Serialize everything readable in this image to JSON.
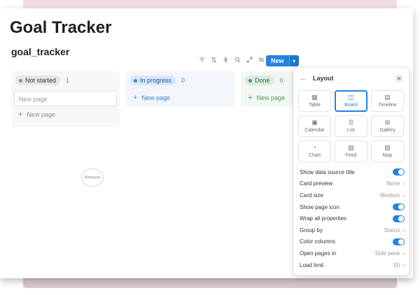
{
  "page": {
    "title": "Goal Tracker"
  },
  "database": {
    "title": "goal_tracker"
  },
  "toolbar": {
    "icons": [
      "filter-icon",
      "sort-icon",
      "lightning-icon",
      "search-icon",
      "expand-icon",
      "settings-icon"
    ],
    "new_label": "New",
    "new_menu_icon": "chevron-down-icon"
  },
  "board": {
    "columns": [
      {
        "label": "Not started",
        "count": "1",
        "card_text": "New page",
        "add_label": "New page",
        "color": "#8f8f8d"
      },
      {
        "label": "In progress",
        "count": "0",
        "add_label": "New page",
        "color": "#3b82d1"
      },
      {
        "label": "Done",
        "count": "0",
        "add_label": "New page",
        "color": "#4a9a5e"
      }
    ]
  },
  "signature": {
    "text": "Shravani"
  },
  "layout_panel": {
    "title": "Layout",
    "layouts": [
      {
        "label": "Table",
        "icon": "table-icon"
      },
      {
        "label": "Board",
        "icon": "board-icon",
        "selected": true
      },
      {
        "label": "Timeline",
        "icon": "timeline-icon"
      },
      {
        "label": "Calendar",
        "icon": "calendar-icon"
      },
      {
        "label": "List",
        "icon": "list-icon"
      },
      {
        "label": "Gallery",
        "icon": "gallery-icon"
      },
      {
        "label": "Chart",
        "icon": "chart-icon"
      },
      {
        "label": "Feed",
        "icon": "feed-icon"
      },
      {
        "label": "Map",
        "icon": "map-icon"
      }
    ],
    "options": [
      {
        "label": "Show data source title",
        "toggle": true
      },
      {
        "label": "Card preview",
        "value": "None"
      },
      {
        "label": "Card size",
        "value": "Medium"
      },
      {
        "label": "Show page icon",
        "toggle": true
      },
      {
        "label": "Wrap all properties",
        "toggle": true
      },
      {
        "label": "Group by",
        "value": "Status"
      },
      {
        "label": "Color columns",
        "toggle": true
      },
      {
        "label": "Open pages in",
        "value": "Side peek"
      },
      {
        "label": "Load limit",
        "value": "50"
      }
    ]
  },
  "colors": {
    "accent": "#2383e2",
    "pink_band": "#f2dce3"
  }
}
